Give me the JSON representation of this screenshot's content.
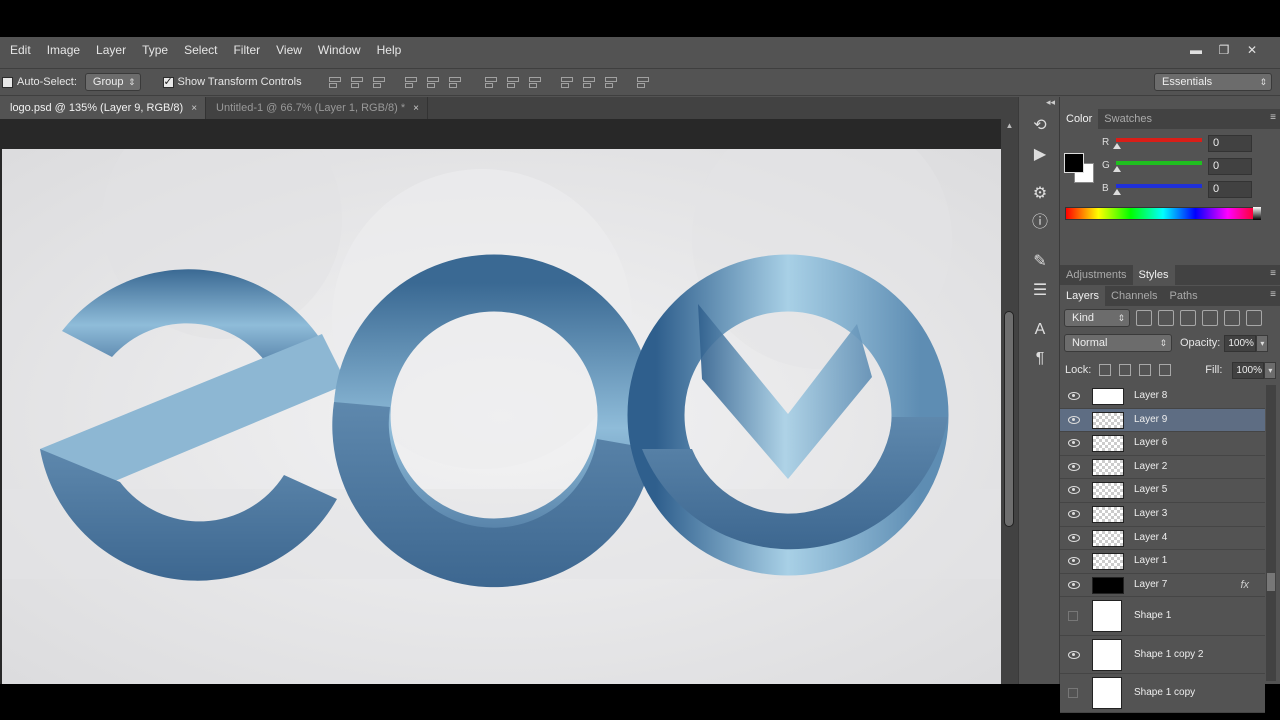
{
  "menu": [
    "Edit",
    "Image",
    "Layer",
    "Type",
    "Select",
    "Filter",
    "View",
    "Window",
    "Help"
  ],
  "window_controls": [
    "▬",
    "❐",
    "✕"
  ],
  "options": {
    "auto_select_label": "Auto-Select:",
    "auto_select_value": "Group",
    "transform_label": "Show Transform Controls",
    "workspace": "Essentials"
  },
  "tabs": [
    {
      "label": "logo.psd @ 135% (Layer 9, RGB/8)",
      "close": "×"
    },
    {
      "label": "Untitled-1 @ 66.7% (Layer 1, RGB/8) *",
      "close": "×"
    }
  ],
  "color_panel": {
    "tabs": [
      "Color",
      "Swatches"
    ],
    "r_label": "R",
    "g_label": "G",
    "b_label": "B",
    "r": "0",
    "g": "0",
    "b": "0",
    "colors": {
      "r": "#d91e18",
      "g": "#1fbf1f",
      "b": "#1f30d9"
    }
  },
  "adjustments_tabs": [
    "Adjustments",
    "Styles"
  ],
  "layers_panel": {
    "tabs": [
      "Layers",
      "Channels",
      "Paths"
    ],
    "kind": "Kind",
    "blend": "Normal",
    "opacity_label": "Opacity:",
    "opacity": "100%",
    "lock_label": "Lock:",
    "fill_label": "Fill:",
    "fill": "100%",
    "fx_label": "fx",
    "layers": [
      {
        "name": "Layer 8",
        "visible": true,
        "thumb": "white",
        "selected": false
      },
      {
        "name": "Layer 9",
        "visible": true,
        "thumb": "checker",
        "selected": true
      },
      {
        "name": "Layer 6",
        "visible": true,
        "thumb": "checker",
        "selected": false
      },
      {
        "name": "Layer 2",
        "visible": true,
        "thumb": "checker",
        "selected": false
      },
      {
        "name": "Layer 5",
        "visible": true,
        "thumb": "checker",
        "selected": false
      },
      {
        "name": "Layer 3",
        "visible": true,
        "thumb": "checker",
        "selected": false
      },
      {
        "name": "Layer 4",
        "visible": true,
        "thumb": "checker",
        "selected": false
      },
      {
        "name": "Layer 1",
        "visible": true,
        "thumb": "checker",
        "selected": false
      },
      {
        "name": "Layer 7",
        "visible": true,
        "thumb": "black",
        "selected": false,
        "fx": true
      },
      {
        "name": "Shape 1",
        "visible": false,
        "thumb": "white",
        "selected": false,
        "tall": true
      },
      {
        "name": "Shape 1 copy 2",
        "visible": true,
        "thumb": "white",
        "selected": false,
        "tall": true
      },
      {
        "name": "Shape 1 copy",
        "visible": false,
        "thumb": "white",
        "selected": false,
        "tall": true
      }
    ]
  },
  "tool_icons": [
    "history-brush-icon",
    "play-action-icon",
    "clone-source-icon",
    "info-icon",
    "brush-presets-icon",
    "adjust-sliders-icon",
    "character-icon",
    "paragraph-icon"
  ],
  "artwork_colors": {
    "ring_dark": "#3f6a93",
    "ring_light": "#9fc9e2",
    "background": "#e9e9eb"
  }
}
